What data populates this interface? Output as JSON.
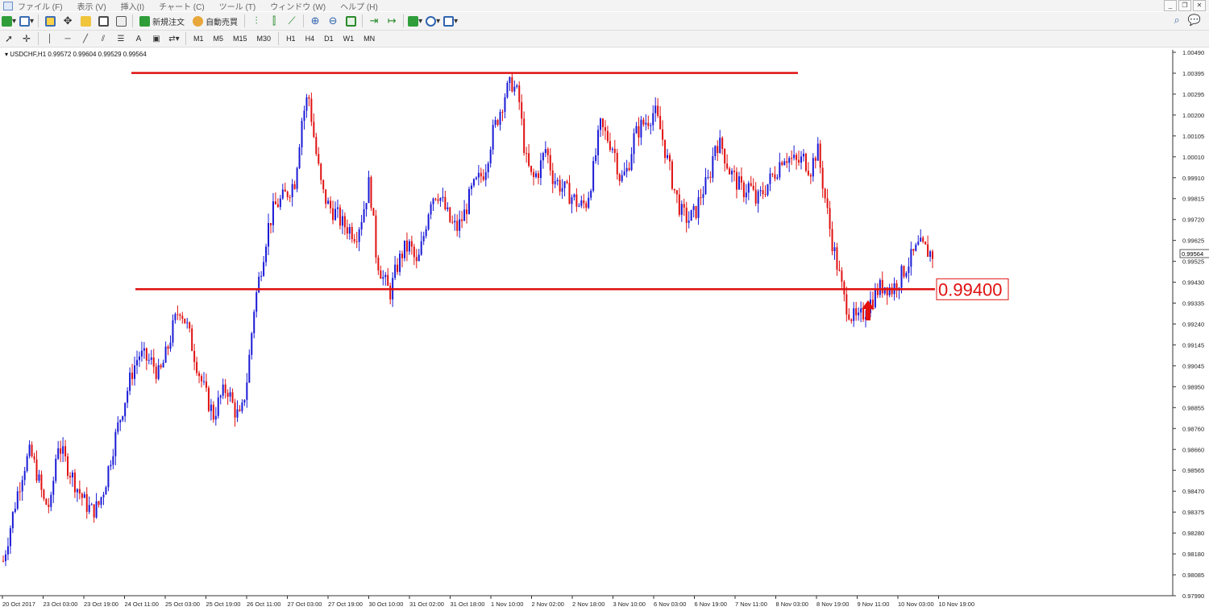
{
  "menu": [
    "ファイル (F)",
    "表示 (V)",
    "挿入(I)",
    "チャート (C)",
    "ツール (T)",
    "ウィンドウ (W)",
    "ヘルプ (H)"
  ],
  "toolbar": {
    "new_order_label": "新規注文",
    "auto_trade_label": "自動売買"
  },
  "timeframes": [
    "M1",
    "M5",
    "M15",
    "M30",
    "H1",
    "H4",
    "D1",
    "W1",
    "MN"
  ],
  "chart_header": "USDCHF,H1  0.99572 0.99604 0.99529 0.99564",
  "chart_data": {
    "type": "candlestick",
    "symbol": "USDCHF",
    "timeframe": "H1",
    "ohlc_header": {
      "open": 0.99572,
      "high": 0.99604,
      "low": 0.99529,
      "close": 0.99564
    },
    "y_ticks": [
      "1.00490",
      "1.00395",
      "1.00295",
      "1.00200",
      "1.00105",
      "1.00010",
      "0.99910",
      "0.99815",
      "0.99720",
      "0.99625",
      "0.99525",
      "0.99430",
      "0.99335",
      "0.99240",
      "0.99145",
      "0.99045",
      "0.98950",
      "0.98855",
      "0.98760",
      "0.98660",
      "0.98565",
      "0.98470",
      "0.98375",
      "0.98280",
      "0.98180",
      "0.98085",
      "0.97990"
    ],
    "ylim": [
      0.9799,
      1.0049
    ],
    "x_ticks": [
      "20 Oct 2017",
      "23 Oct 03:00",
      "23 Oct 19:00",
      "24 Oct 11:00",
      "25 Oct 03:00",
      "25 Oct 19:00",
      "26 Oct 11:00",
      "27 Oct 03:00",
      "27 Oct 19:00",
      "30 Oct 10:00",
      "31 Oct 02:00",
      "31 Oct 18:00",
      "1 Nov 10:00",
      "2 Nov 02:00",
      "2 Nov 18:00",
      "3 Nov 10:00",
      "6 Nov 03:00",
      "6 Nov 19:00",
      "7 Nov 11:00",
      "8 Nov 03:00",
      "8 Nov 19:00",
      "9 Nov 11:00",
      "10 Nov 03:00",
      "10 Nov 19:00"
    ],
    "current_price_label": "0.99564",
    "current_price": 0.99564,
    "resistance_level": 1.00395,
    "support_level": 0.994,
    "support_label": "0.99400",
    "path": [
      0.9815,
      0.983,
      0.9845,
      0.9858,
      0.9865,
      0.9855,
      0.9842,
      0.984,
      0.987,
      0.9862,
      0.9855,
      0.9848,
      0.9842,
      0.9838,
      0.984,
      0.985,
      0.9865,
      0.9878,
      0.989,
      0.9902,
      0.991,
      0.9908,
      0.9906,
      0.99,
      0.991,
      0.9922,
      0.9932,
      0.9924,
      0.9912,
      0.99,
      0.989,
      0.9882,
      0.989,
      0.9895,
      0.9885,
      0.988,
      0.99,
      0.9932,
      0.995,
      0.9968,
      0.9978,
      0.9981,
      0.9985,
      0.999,
      1.0018,
      1.003,
      1.0005,
      0.9985,
      0.9978,
      0.9975,
      0.997,
      0.9968,
      0.9965,
      0.9975,
      0.999,
      0.9955,
      0.9945,
      0.9938,
      0.995,
      0.9958,
      0.996,
      0.995,
      0.9965,
      0.9982,
      0.9985,
      0.9978,
      0.997,
      0.9968,
      0.9975,
      0.9985,
      0.999,
      0.9995,
      1.001,
      1.002,
      1.003,
      1.0035,
      1.0028,
      1.0,
      0.999,
      0.9995,
      1.0005,
      0.9992,
      0.9988,
      0.9985,
      0.9982,
      0.9978,
      0.998,
      0.9995,
      1.0015,
      1.001,
      1.0005,
      0.999,
      0.9995,
      1.001,
      1.0015,
      1.0018,
      1.0022,
      1.0012,
      0.9998,
      0.9985,
      0.9975,
      0.9972,
      0.9975,
      0.9985,
      0.999,
      1.0008,
      1.0005,
      0.9995,
      0.999,
      0.9985,
      0.9988,
      0.998,
      0.9985,
      0.999,
      0.9995,
      1.0002,
      1.0,
      0.9998,
      1.0,
      0.9995,
      1.0005,
      0.9985,
      0.9965,
      0.995,
      0.9935,
      0.9928,
      0.9925,
      0.993,
      0.9935,
      0.994,
      0.9942,
      0.994,
      0.9944,
      0.995,
      0.9955,
      0.996,
      0.9958,
      0.9956
    ]
  },
  "annotations": {
    "arrow_label": "",
    "support_box_text": "0.99400"
  },
  "colors": {
    "bull": "#1a1ad6",
    "bear": "#e01010",
    "line": "#e01010",
    "axis": "#333333"
  }
}
